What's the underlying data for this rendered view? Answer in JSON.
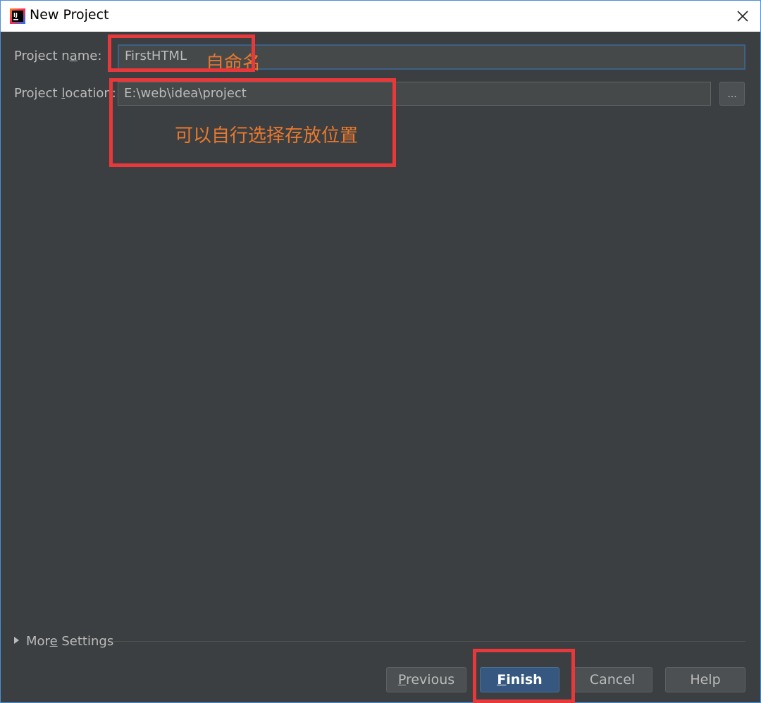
{
  "window": {
    "title": "New Project",
    "app_icon_text": "IJ"
  },
  "form": {
    "name_label_pre": "Project n",
    "name_label_mnemonic": "a",
    "name_label_post": "me:",
    "name_value": "FirstHTML",
    "location_label_pre": "Project ",
    "location_label_mnemonic": "l",
    "location_label_post": "ocation:",
    "location_value": "E:\\web\\idea\\project",
    "browse_label": "..."
  },
  "annotations": {
    "name_note": "自命名",
    "location_note": "可以自行选择存放位置",
    "color": "#e8782e",
    "box_color": "#e8383a"
  },
  "more_settings": {
    "pre": "Mor",
    "mnemonic": "e",
    "post": " Settings"
  },
  "buttons": {
    "previous_mnemonic": "P",
    "previous_rest": "revious",
    "finish_mnemonic": "F",
    "finish_rest": "inish",
    "cancel": "Cancel",
    "help": "Help"
  },
  "icons": [
    "intellij-app-icon",
    "close-icon",
    "expand-triangle-icon"
  ],
  "colors": {
    "background": "#3c3f41",
    "primary_button": "#365880",
    "field_focus_border": "#3d6185"
  }
}
